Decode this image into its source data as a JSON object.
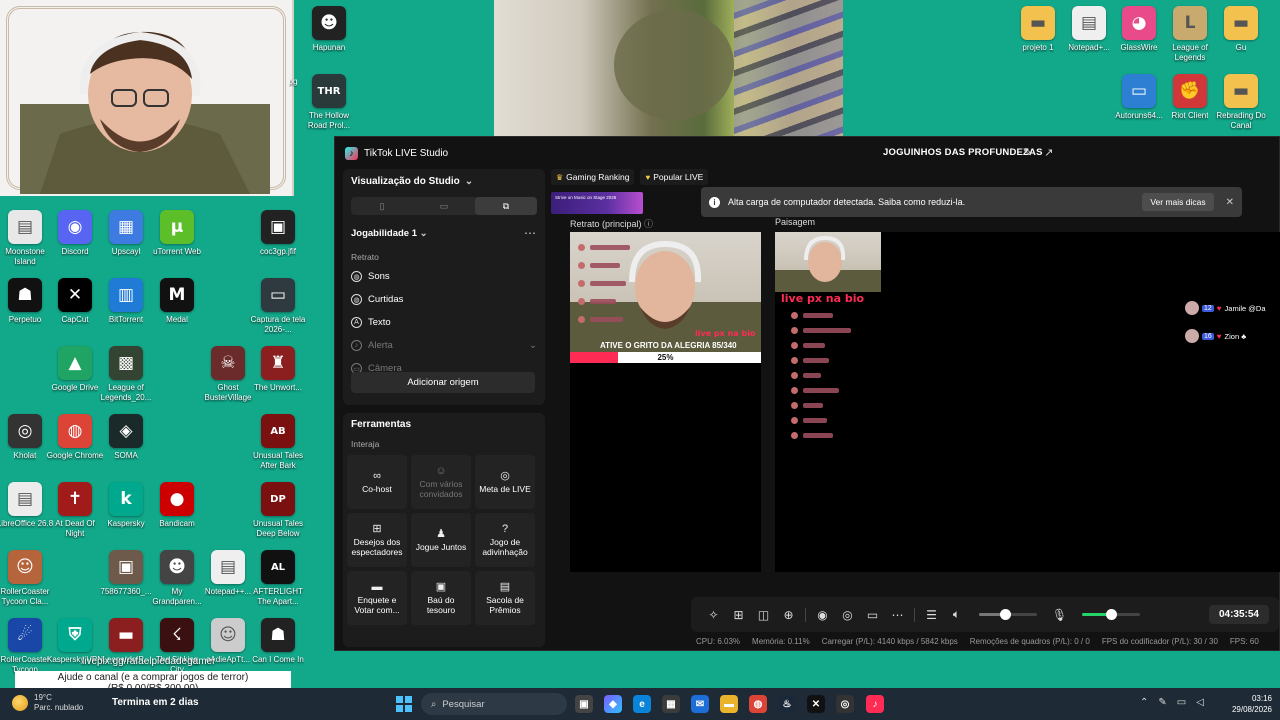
{
  "desktop": {
    "icons_left": [
      {
        "label": "Moonstone Island",
        "icon": "document-icon",
        "color": "#e8e8e8",
        "glyph": "▤"
      },
      {
        "label": "Discord",
        "icon": "discord-icon",
        "color": "#5865f2",
        "glyph": "◉"
      },
      {
        "label": "Upscayl",
        "icon": "upscayl-icon",
        "color": "#3d7be0",
        "glyph": "▦"
      },
      {
        "label": "uTorrent Web",
        "icon": "utorrent-icon",
        "color": "#5cbf2a",
        "glyph": "μ"
      },
      {
        "label": "coc3gp.jfif",
        "icon": "image-file-icon",
        "color": "#222222",
        "glyph": "▣"
      },
      {
        "label": "Perpetuo",
        "icon": "app-icon",
        "color": "#111111",
        "glyph": "☗"
      },
      {
        "label": "CapCut",
        "icon": "capcut-icon",
        "color": "#000000",
        "glyph": "✕"
      },
      {
        "label": "BitTorrent",
        "icon": "bittorrent-icon",
        "color": "#1f7bd6",
        "glyph": "▥"
      },
      {
        "label": "Medal",
        "icon": "medal-icon",
        "color": "#111111",
        "glyph": "M"
      },
      {
        "label": "Captura de tela 2026-...",
        "icon": "screenshot-icon",
        "color": "#2e3a3f",
        "glyph": "▭"
      },
      {
        "label": "Google Drive",
        "icon": "google-drive-icon",
        "color": "#1fa463",
        "glyph": "▲"
      },
      {
        "label": "League of Legends_20...",
        "icon": "video-file-icon",
        "color": "#334433",
        "glyph": "▩"
      },
      {
        "label": "Ghost BusterVillage",
        "icon": "game-icon",
        "color": "#6b2b2b",
        "glyph": "☠"
      },
      {
        "label": "The Unwort...",
        "icon": "game-icon",
        "color": "#8b1e1e",
        "glyph": "♜"
      },
      {
        "label": "Kholat",
        "icon": "game-icon",
        "color": "#333333",
        "glyph": "◎"
      },
      {
        "label": "Google Chrome",
        "icon": "chrome-icon",
        "color": "#db4437",
        "glyph": "◍"
      },
      {
        "label": "SOMA",
        "icon": "game-icon",
        "color": "#1a2a2a",
        "glyph": "◈"
      },
      {
        "label": "Unusual Tales After Bark",
        "icon": "game-icon",
        "color": "#7a1010",
        "glyph": "AB"
      },
      {
        "label": "LibreOffice 26.8",
        "icon": "libreoffice-icon",
        "color": "#ececec",
        "glyph": "▤"
      },
      {
        "label": "At Dead Of Night",
        "icon": "game-icon",
        "color": "#a11b1b",
        "glyph": "✝"
      },
      {
        "label": "Kaspersky",
        "icon": "kaspersky-icon",
        "color": "#00a88e",
        "glyph": "k"
      },
      {
        "label": "Bandicam",
        "icon": "bandicam-icon",
        "color": "#cc0000",
        "glyph": "●"
      },
      {
        "label": "Unusual Tales Deep Below",
        "icon": "game-icon",
        "color": "#7a1010",
        "glyph": "DP"
      },
      {
        "label": "RollerCoaster Tycoon Cla...",
        "icon": "game-icon",
        "color": "#b5643c",
        "glyph": "☺"
      },
      {
        "label": "758677360_...",
        "icon": "image-file-icon",
        "color": "#6d5a4a",
        "glyph": "▣"
      },
      {
        "label": "My Grandparen...",
        "icon": "game-icon",
        "color": "#444444",
        "glyph": "☻"
      },
      {
        "label": "Notepad++...",
        "icon": "notepad-icon",
        "color": "#efefef",
        "glyph": "▤"
      },
      {
        "label": "AFTERLIGHT The Apart...",
        "icon": "game-icon",
        "color": "#111111",
        "glyph": "AL"
      },
      {
        "label": "RollerCoaster Tycoon",
        "icon": "game-icon",
        "color": "#1947a8",
        "glyph": "☄"
      },
      {
        "label": "Kaspersky VPN",
        "icon": "kaspersky-vpn-icon",
        "color": "#00a88e",
        "glyph": "⛨"
      },
      {
        "label": "Leonardo P...",
        "icon": "game-icon",
        "color": "#8b1e1e",
        "glyph": "▬"
      },
      {
        "label": "The Sinking City",
        "icon": "game-icon",
        "color": "#3a1010",
        "glyph": "☇"
      },
      {
        "label": "oAdieApTt...",
        "icon": "image-file-icon",
        "color": "#cccccc",
        "glyph": "☺"
      },
      {
        "label": "Can I Come In",
        "icon": "game-icon",
        "color": "#222222",
        "glyph": "☗"
      },
      {
        "label": "Hapunan",
        "icon": "game-icon",
        "color": "#222222",
        "glyph": "☻"
      },
      {
        "label": "The Hollow Road Prol...",
        "icon": "game-icon",
        "color": "#2a3a3a",
        "glyph": "THR"
      },
      {
        "label": "pg",
        "icon": "file-icon",
        "color": "#12a88a",
        "glyph": ""
      }
    ],
    "icons_right": [
      {
        "label": "projeto 1",
        "icon": "folder-icon",
        "color": "#f2c14e",
        "glyph": "▬"
      },
      {
        "label": "Notepad+...",
        "icon": "notepad-icon",
        "color": "#efefef",
        "glyph": "▤"
      },
      {
        "label": "GlassWire",
        "icon": "glasswire-icon",
        "color": "#e84a8a",
        "glyph": "◕"
      },
      {
        "label": "League of Legends",
        "icon": "league-icon",
        "color": "#c8aa6e",
        "glyph": "L"
      },
      {
        "label": "Gu",
        "icon": "folder-icon",
        "color": "#f2c14e",
        "glyph": "▬"
      },
      {
        "label": "Autoruns64...",
        "icon": "autoruns-icon",
        "color": "#2d7fd3",
        "glyph": "▭"
      },
      {
        "label": "Riot Client",
        "icon": "riot-icon",
        "color": "#d13639",
        "glyph": "✊"
      },
      {
        "label": "Rebrading Do Canal",
        "icon": "folder-icon",
        "color": "#f2c14e",
        "glyph": "▬"
      }
    ]
  },
  "studio": {
    "app_title": "TikTok LIVE Studio",
    "stream_title": "JOGUINHOS DAS PROFUNDEZAS",
    "view_label": "Visualização do Studio",
    "scene_name": "Jogabilidade 1",
    "section_label": "Retrato",
    "sources": [
      {
        "label": "Sons",
        "icon": "globe-icon",
        "dim": false
      },
      {
        "label": "Curtidas",
        "icon": "globe-icon",
        "dim": false
      },
      {
        "label": "Texto",
        "icon": "text-icon",
        "dim": false
      },
      {
        "label": "Alerta",
        "icon": "bell-icon",
        "dim": true
      },
      {
        "label": "Câmera",
        "icon": "camera-icon",
        "dim": true
      }
    ],
    "add_source": "Adicionar origem",
    "tools_title": "Ferramentas",
    "tools_sub": "Interaja",
    "tools": [
      {
        "label": "Co-host",
        "icon": "link-icon",
        "glyph": "∞",
        "dim": false
      },
      {
        "label": "Com vários convidados",
        "icon": "guests-icon",
        "glyph": "☺",
        "dim": true
      },
      {
        "label": "Meta de LIVE",
        "icon": "target-icon",
        "glyph": "◎",
        "dim": false
      },
      {
        "label": "Desejos dos espectadores",
        "icon": "gift-icon",
        "glyph": "⊞",
        "dim": false
      },
      {
        "label": "Jogue Juntos",
        "icon": "player-icon",
        "glyph": "♟",
        "dim": false
      },
      {
        "label": "Jogo de adivinhação",
        "icon": "question-icon",
        "glyph": "?",
        "dim": false
      },
      {
        "label": "Enquete e Votar com...",
        "icon": "poll-icon",
        "glyph": "▬",
        "dim": false
      },
      {
        "label": "Baú do tesouro",
        "icon": "chest-icon",
        "glyph": "▣",
        "dim": false
      },
      {
        "label": "Sacola de Prêmios",
        "icon": "bag-icon",
        "glyph": "▤",
        "dim": false
      }
    ],
    "chips": [
      "Gaming Ranking",
      "Popular LIVE"
    ],
    "promo_text": "Strive on Music on Stage 2026",
    "banner_text": "Alta carga de computador detectada. Saiba como reduzi-la.",
    "banner_button": "Ver mais dicas",
    "portrait_label": "Retrato (principal)",
    "landscape_label": "Paisagem",
    "overlay_live_text": "live px na bio",
    "goal_text": "ATIVE O GRITO DA ALEGRIA  85/340",
    "goal_percent": "25%",
    "goal_fraction": 0.25,
    "viewers": [
      {
        "level": "12",
        "name": "Jamile @Da"
      },
      {
        "level": "16",
        "name": "Zion ♣"
      }
    ],
    "timer": "04:35:54",
    "volume_level": 0.45,
    "mic_level": 0.5,
    "status": {
      "cpu": "CPU: 6.03%",
      "memory": "Memória: 0.11%",
      "upload": "Carregar (P/L): 4140 kbps / 5842 kbps",
      "dropped": "Remoções de quadros (P/L): 0 / 0",
      "encoder_fps": "FPS do codificador (P/L): 30 / 30",
      "fps": "FPS: 60"
    }
  },
  "overlay": {
    "link": "livepix.gg/rafaelpiedadegamer",
    "line1": "Ajude o canal (e a comprar jogos de terror)",
    "line2": "(R$ 0.00/R$ 300.00)"
  },
  "taskbar": {
    "temp": "19°C",
    "weather": "Parc. nublado",
    "news": "Termina em 2 dias",
    "search_placeholder": "Pesquisar",
    "time": "03:16",
    "date": "29/08/2026"
  },
  "colors": {
    "desktop_bg": "#12a88a",
    "tiktok_red": "#fe2c55",
    "tiktok_cyan": "#25f4ee",
    "panel_bg": "#121212"
  }
}
